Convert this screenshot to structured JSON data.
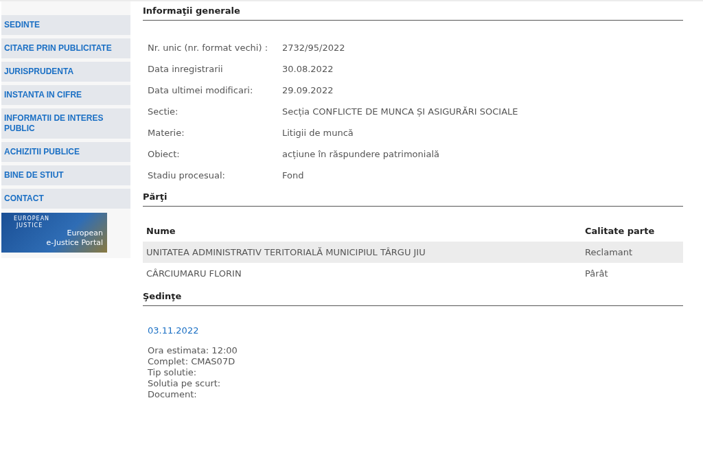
{
  "sidebar": {
    "items": [
      {
        "label": "SEDINTE"
      },
      {
        "label": "CITARE PRIN PUBLICITATE"
      },
      {
        "label": "JURISPRUDENTA"
      },
      {
        "label": "INSTANTA IN CIFRE"
      },
      {
        "label": "INFORMATII DE INTERES PUBLIC"
      },
      {
        "label": "ACHIZITII PUBLICE"
      },
      {
        "label": "BINE DE STIUT"
      },
      {
        "label": "CONTACT"
      }
    ],
    "banner": {
      "logo_text_top": "EUROPEAN",
      "logo_text_bottom": "JUSTICE",
      "title_line1": "European",
      "title_line2": "e-Justice Portal"
    }
  },
  "general": {
    "title": "Informaţii generale",
    "fields": [
      {
        "label": "Nr. unic (nr. format vechi) :",
        "value": "2732/95/2022"
      },
      {
        "label": "Data inregistrarii",
        "value": "30.08.2022"
      },
      {
        "label": "Data ultimei modificari:",
        "value": "29.09.2022"
      },
      {
        "label": "Sectie:",
        "value": "Secția CONFLICTE DE MUNCA ȘI ASIGURĂRI SOCIALE"
      },
      {
        "label": "Materie:",
        "value": "Litigii de muncă"
      },
      {
        "label": "Obiect:",
        "value": "acțiune în răspundere patrimonială"
      },
      {
        "label": "Stadiu procesual:",
        "value": "Fond"
      }
    ]
  },
  "parties": {
    "title": "Părţi",
    "columns": [
      "Nume",
      "Calitate parte"
    ],
    "rows": [
      {
        "name": "UNITATEA ADMINISTRATIV TERITORIALĂ MUNICIPIUL TÂRGU JIU",
        "role": "Reclamant"
      },
      {
        "name": "CÂRCIUMARU FLORIN",
        "role": "Pârât"
      }
    ]
  },
  "hearings": {
    "title": "Şedinţe",
    "items": [
      {
        "date": "03.11.2022",
        "lines": [
          "Ora estimata: 12:00",
          "Complet: CMAS07D",
          "Tip solutie:",
          "Solutia pe scurt:",
          "Document:"
        ]
      }
    ]
  }
}
